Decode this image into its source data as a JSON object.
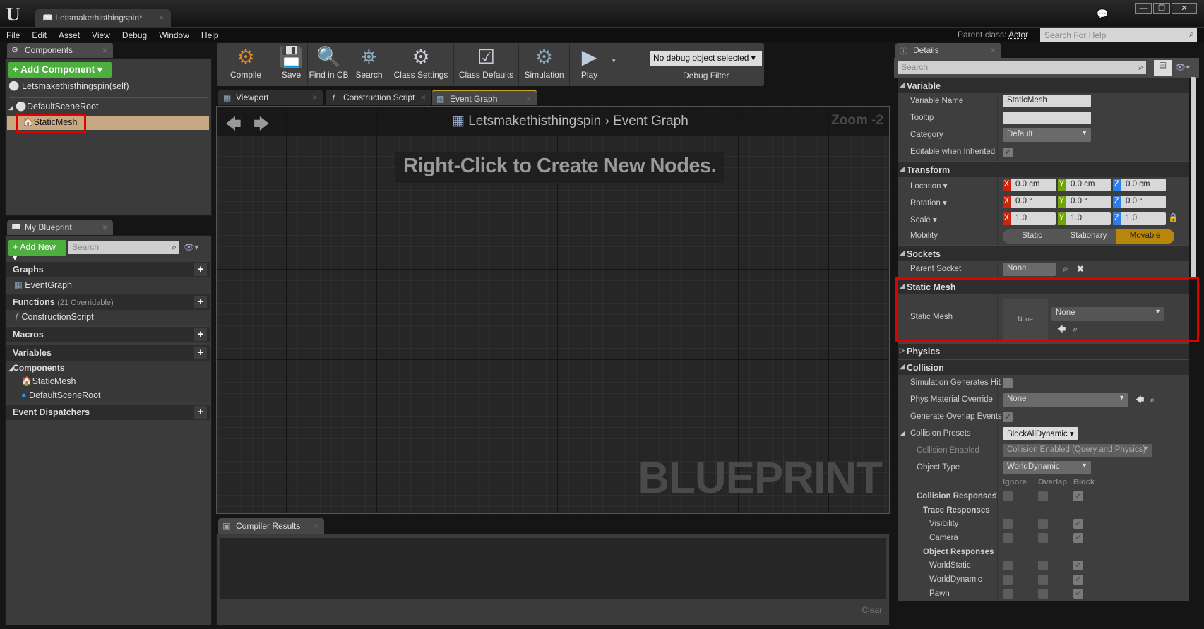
{
  "window": {
    "doc_tab": "Letsmakethisthingspin*",
    "controls": [
      "—",
      "❐",
      "✕"
    ]
  },
  "menu": [
    "File",
    "Edit",
    "Asset",
    "View",
    "Debug",
    "Window",
    "Help"
  ],
  "header": {
    "parent_class_label": "Parent class:",
    "parent_class": "Actor",
    "help_search_placeholder": "Search For Help"
  },
  "components": {
    "tab": "Components",
    "add_button": "+ Add Component ▾",
    "self": "Letsmakethisthingspin(self)",
    "root": "DefaultSceneRoot",
    "selected": "StaticMesh"
  },
  "my_blueprint": {
    "tab": "My Blueprint",
    "add_new": "+ Add New ▾",
    "search_placeholder": "Search",
    "graphs": "Graphs",
    "event_graph": "EventGraph",
    "functions": "Functions",
    "functions_note": "(21 Overridable)",
    "construction_script": "ConstructionScript",
    "macros": "Macros",
    "variables": "Variables",
    "components_cat": "Components",
    "var_items": [
      "StaticMesh",
      "DefaultSceneRoot"
    ],
    "event_dispatchers": "Event Dispatchers"
  },
  "toolbar": {
    "buttons": [
      "Compile",
      "Save",
      "Find in CB",
      "Search",
      "Class Settings",
      "Class Defaults",
      "Simulation",
      "Play"
    ],
    "debug_select": "No debug object selected ▾",
    "debug_label": "Debug Filter"
  },
  "editor_tabs": [
    "Viewport",
    "Construction Script",
    "Event Graph"
  ],
  "graph": {
    "breadcrumb_root": "Letsmakethisthingspin",
    "breadcrumb_sep": "›",
    "breadcrumb_leaf": "Event Graph",
    "zoom": "Zoom -2",
    "hint": "Right-Click to Create New Nodes.",
    "watermark": "BLUEPRINT"
  },
  "compiler": {
    "tab": "Compiler Results",
    "clear": "Clear"
  },
  "details": {
    "tab": "Details",
    "search_placeholder": "Search",
    "sections": [
      {
        "title": "Variable",
        "expanded": true,
        "rows": [
          {
            "type": "text",
            "label": "Variable Name",
            "value": "StaticMesh"
          },
          {
            "type": "text",
            "label": "Tooltip",
            "value": ""
          },
          {
            "type": "combo",
            "label": "Category",
            "value": "Default"
          },
          {
            "type": "check",
            "label": "Editable when Inherited",
            "checked": true
          }
        ]
      },
      {
        "title": "Transform",
        "expanded": true,
        "rows": [
          {
            "type": "vec",
            "label": "Location ▾",
            "values": [
              "0.0 cm",
              "0.0 cm",
              "0.0 cm"
            ]
          },
          {
            "type": "vec",
            "label": "Rotation ▾",
            "values": [
              "0.0 °",
              "0.0 °",
              "0.0 °"
            ]
          },
          {
            "type": "vec",
            "label": "Scale ▾",
            "values": [
              "1.0",
              "1.0",
              "1.0"
            ],
            "lock": true
          },
          {
            "type": "mobility",
            "label": "Mobility",
            "options": [
              "Static",
              "Stationary",
              "Movable"
            ],
            "selected": "Movable"
          }
        ]
      },
      {
        "title": "Sockets",
        "expanded": true,
        "rows": [
          {
            "type": "socket",
            "label": "Parent Socket",
            "value": "None"
          }
        ]
      },
      {
        "title": "Static Mesh",
        "expanded": true,
        "highlight": true,
        "rows": [
          {
            "type": "mesh",
            "label": "Static Mesh",
            "thumb": "None",
            "value": "None"
          }
        ]
      },
      {
        "title": "Physics",
        "expanded": false,
        "rows": []
      },
      {
        "title": "Collision",
        "expanded": true,
        "rows": [
          {
            "type": "check",
            "label": "Simulation Generates Hit",
            "checked": false
          },
          {
            "type": "asset",
            "label": "Phys Material Override",
            "value": "None"
          },
          {
            "type": "check",
            "label": "Generate Overlap Events",
            "checked": true
          },
          {
            "type": "button",
            "label": "Collision Presets",
            "value": "BlockAllDynamic ▾",
            "tri": true
          },
          {
            "type": "combo",
            "label": "Collision Enabled",
            "value": "Collision Enabled (Query and Physics)",
            "dim": true,
            "indent": 1
          },
          {
            "type": "combo",
            "label": "Object Type",
            "value": "WorldDynamic",
            "indent": 1
          },
          {
            "type": "colheads",
            "label": "",
            "cols": [
              "Ignore",
              "Overlap",
              "Block"
            ]
          },
          {
            "type": "resp",
            "label": "Collision Responses",
            "bold": true,
            "indent": 1,
            "checks": [
              false,
              false,
              true
            ]
          },
          {
            "type": "heading",
            "label": "Trace Responses",
            "indent": 2
          },
          {
            "type": "resp",
            "label": "Visibility",
            "indent": 3,
            "checks": [
              false,
              false,
              true
            ]
          },
          {
            "type": "resp",
            "label": "Camera",
            "indent": 3,
            "checks": [
              false,
              false,
              true
            ]
          },
          {
            "type": "heading",
            "label": "Object Responses",
            "indent": 2
          },
          {
            "type": "resp",
            "label": "WorldStatic",
            "indent": 3,
            "checks": [
              false,
              false,
              true
            ]
          },
          {
            "type": "resp",
            "label": "WorldDynamic",
            "indent": 3,
            "checks": [
              false,
              false,
              true
            ]
          },
          {
            "type": "resp",
            "label": "Pawn",
            "indent": 3,
            "checks": [
              false,
              false,
              true
            ]
          }
        ]
      }
    ]
  },
  "colors": {
    "accent_green": "#4caf3e",
    "selection": "#c8a882",
    "movable": "#b8860b",
    "highlight_red": "#e00000",
    "axis_x": "#c8260c",
    "axis_y": "#6fa40a",
    "axis_z": "#2d7ee8"
  }
}
